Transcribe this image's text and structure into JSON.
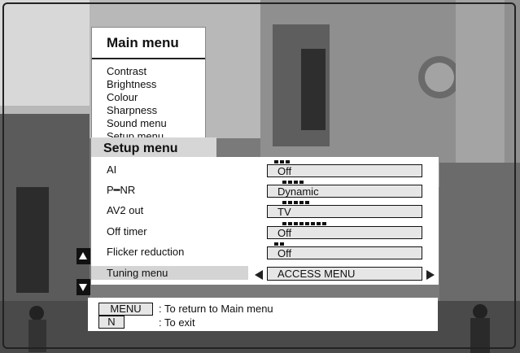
{
  "main_menu": {
    "title": "Main menu",
    "items": [
      "Contrast",
      "Brightness",
      "Colour",
      "Sharpness",
      "Sound menu",
      "Setup menu"
    ]
  },
  "setup_menu": {
    "title": "Setup menu",
    "rows": [
      {
        "label": "AI",
        "value": "Off"
      },
      {
        "label": "P━NR",
        "value": "Dynamic"
      },
      {
        "label": "AV2 out",
        "value": "TV"
      },
      {
        "label": "Off timer",
        "value": "Off"
      },
      {
        "label": "Flicker reduction",
        "value": "Off"
      }
    ],
    "selected_row": {
      "label": "Tuning menu",
      "value": "ACCESS MENU"
    }
  },
  "help": {
    "menu_key": "MENU",
    "menu_text": ": To return to Main menu",
    "n_key": "N",
    "n_text": ": To exit"
  },
  "colors": {
    "panel": "#ffffff",
    "highlight": "#d4d4d4",
    "field": "#e6e6e6",
    "text": "#111111"
  },
  "icons": [
    "scroll-up-arrow-icon",
    "scroll-down-arrow-icon",
    "left-arrow-icon",
    "right-arrow-icon"
  ]
}
